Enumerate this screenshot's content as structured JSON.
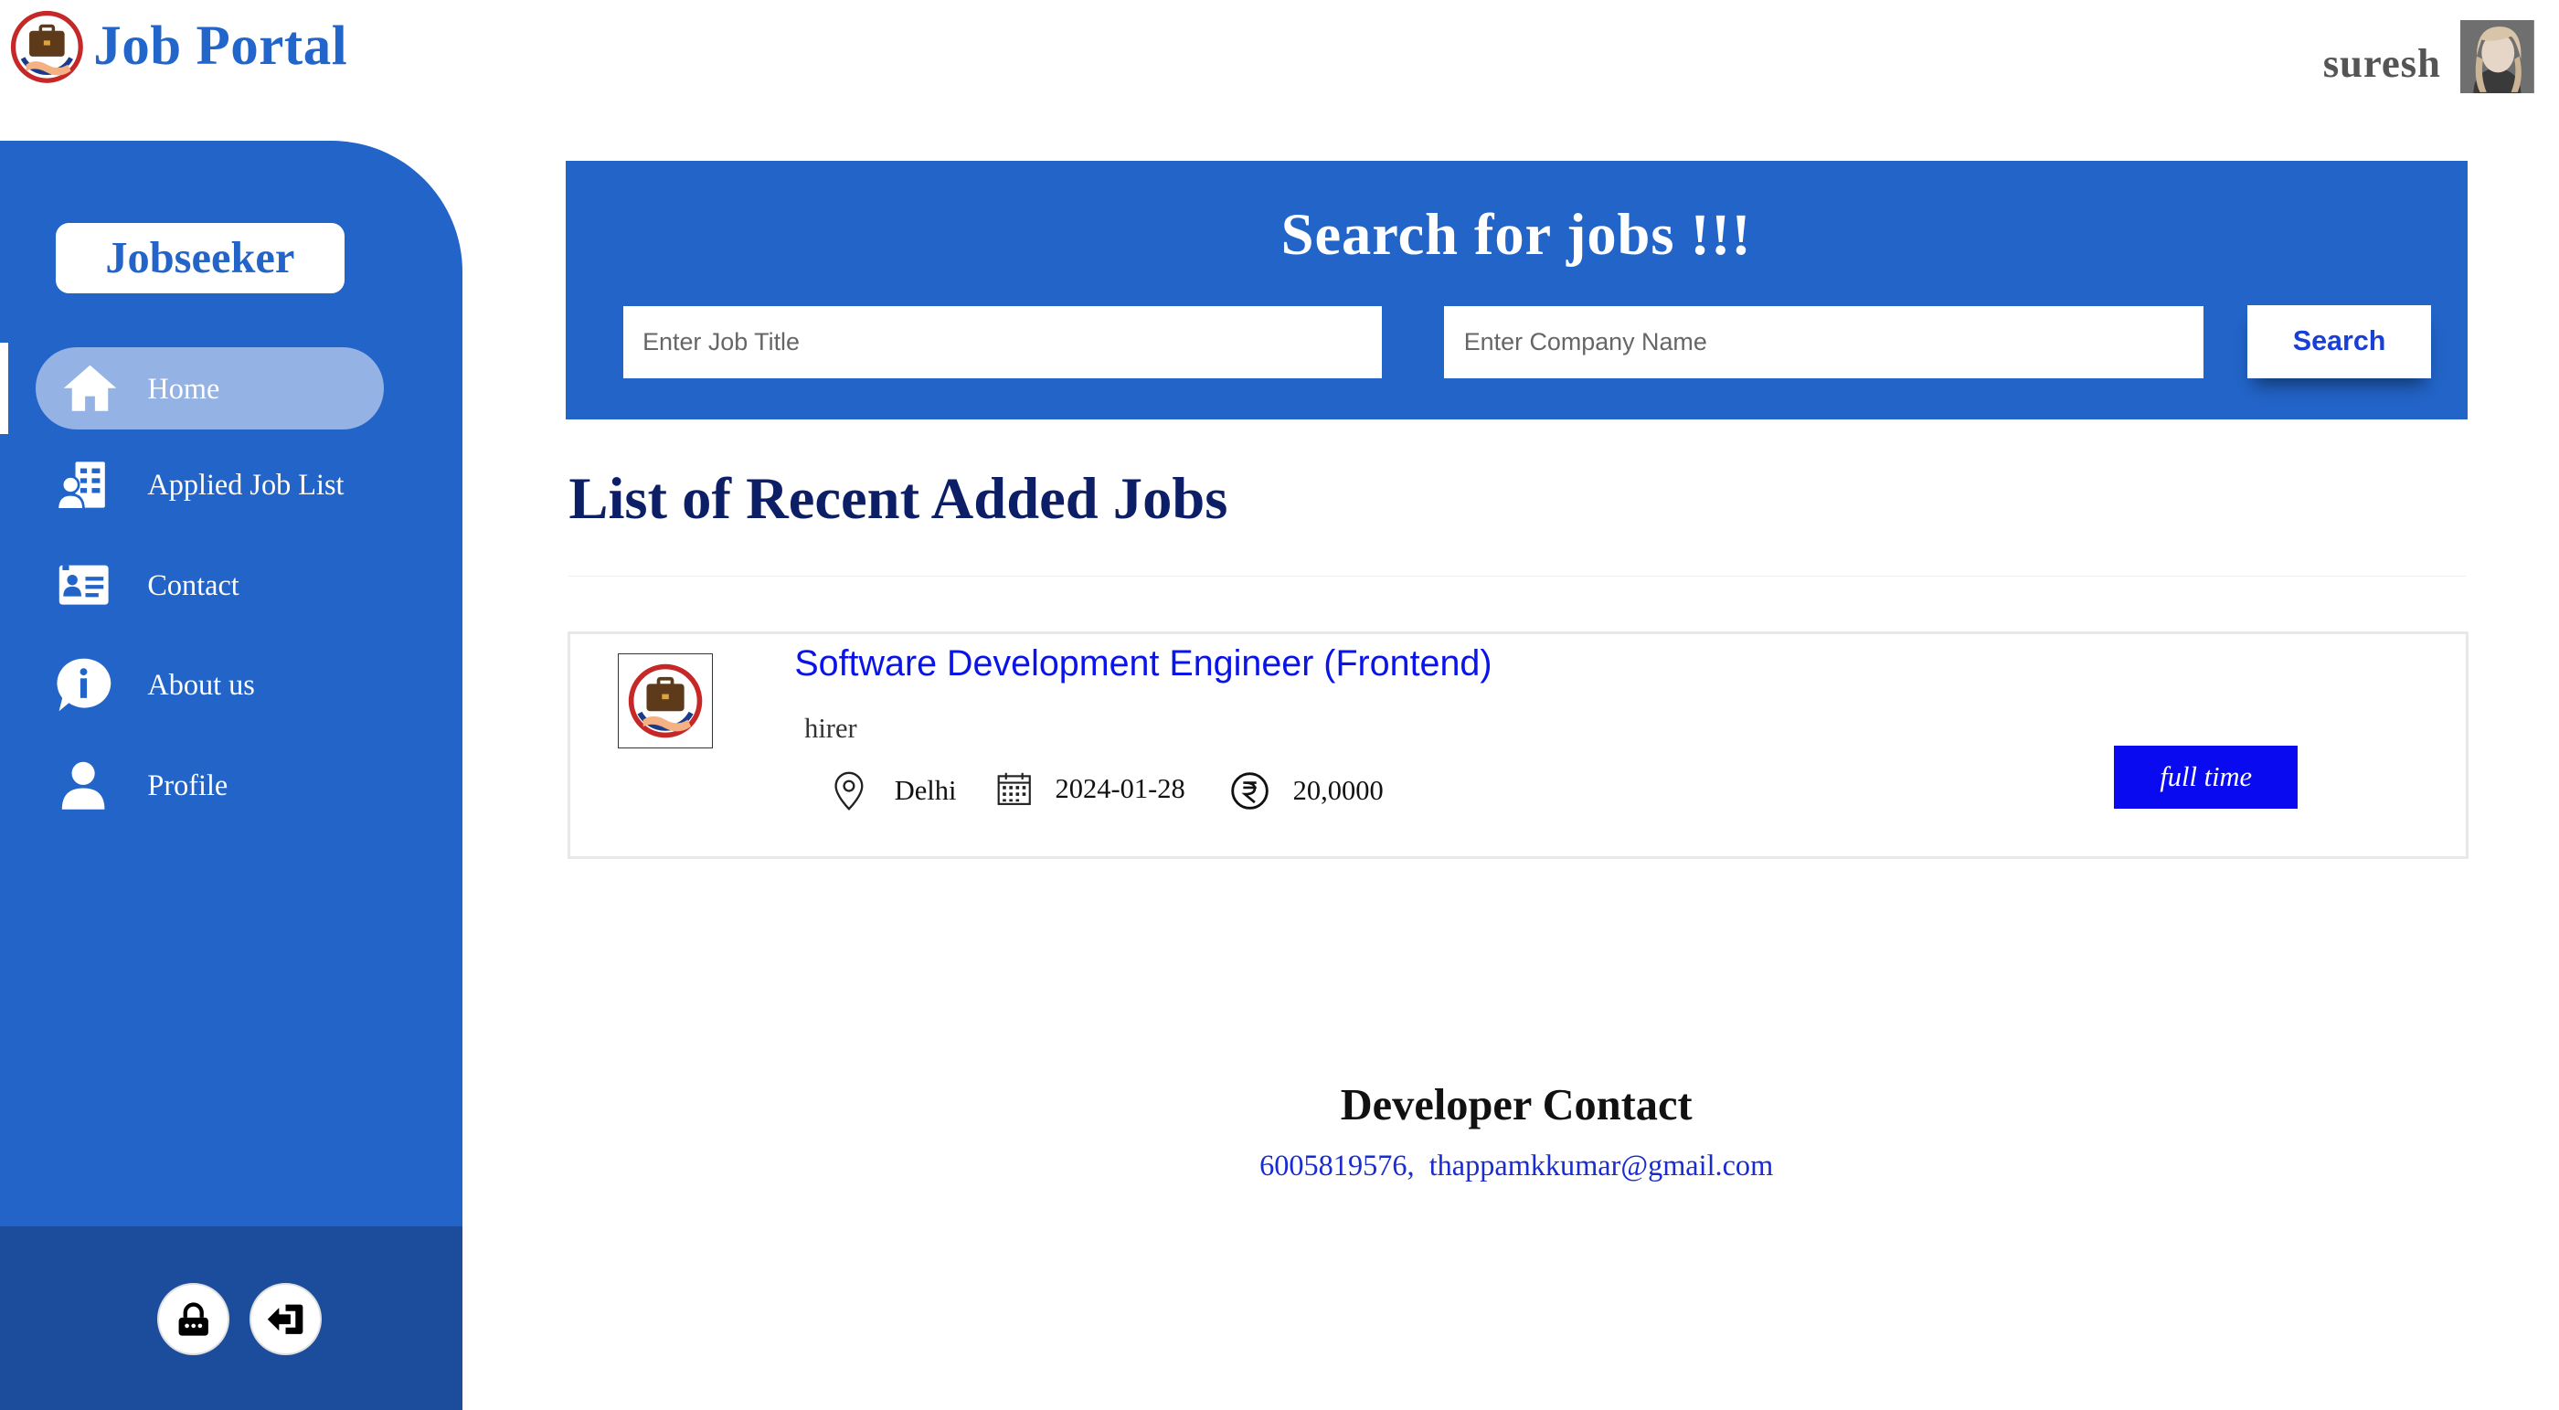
{
  "header": {
    "app_title": "Job Portal",
    "logo_icon": "briefcase-handshake-logo",
    "user_name": "suresh",
    "avatar_icon": "user-avatar-photo"
  },
  "sidebar": {
    "role_label": "Jobseeker",
    "accent_color": "#2264c8",
    "items": [
      {
        "label": "Home",
        "icon": "home-icon",
        "active": true
      },
      {
        "label": "Applied Job List",
        "icon": "applied-list-icon",
        "active": false
      },
      {
        "label": "Contact",
        "icon": "contact-card-icon",
        "active": false
      },
      {
        "label": "About us",
        "icon": "info-icon",
        "active": false
      },
      {
        "label": "Profile",
        "icon": "user-icon",
        "active": false
      }
    ],
    "footer_buttons": [
      {
        "icon": "lock-icon"
      },
      {
        "icon": "logout-icon"
      }
    ]
  },
  "search": {
    "heading": "Search for jobs !!!",
    "job_title_placeholder": "Enter Job Title",
    "company_placeholder": "Enter Company Name",
    "button_label": "Search"
  },
  "jobs": {
    "heading": "List of Recent Added Jobs",
    "items": [
      {
        "title": "Software Development Engineer (Frontend)",
        "company": "hirer",
        "location": "Delhi",
        "date": "2024-01-28",
        "salary": "20,0000",
        "type": "full time"
      }
    ]
  },
  "footer": {
    "heading": "Developer Contact",
    "phone": "6005819576",
    "separator": ",",
    "email": "thappamkkumar@gmail.com"
  }
}
